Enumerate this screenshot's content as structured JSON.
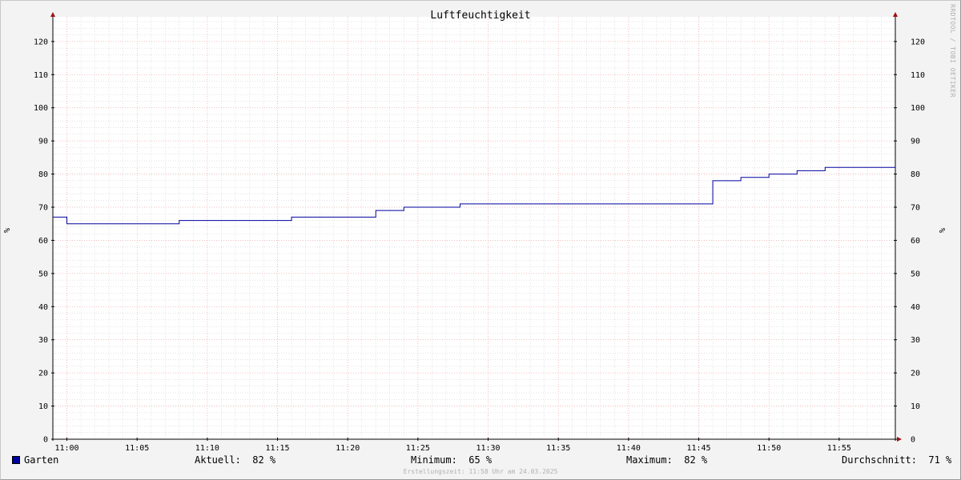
{
  "colors": {
    "line": "#00009e",
    "grid_major": "#f4a0a0",
    "grid_minor": "#c8c8c8",
    "axis": "#000000",
    "arrow": "#a01010"
  },
  "watermark": "RRDTOOL / TOBI OETIKER",
  "footer": "Erstellungszeit: 11:58 Uhr am 24.03.2025",
  "legend": {
    "series_name": "Garten",
    "aktuell_label": "Aktuell:",
    "aktuell_value": "82 %",
    "minimum_label": "Minimum:",
    "minimum_value": "65 %",
    "maximum_label": "Maximum:",
    "maximum_value": "82 %",
    "durchschnitt_label": "Durchschnitt:",
    "durchschnitt_value": "71 %"
  },
  "chart_data": {
    "type": "line",
    "title": "Luftfeuchtigkeit",
    "ylabel": "%",
    "ylabel_right": "%",
    "xlim": [
      "10:59",
      "11:59"
    ],
    "ylim": [
      0,
      126
    ],
    "y_ticks": [
      0,
      10,
      20,
      30,
      40,
      50,
      60,
      70,
      80,
      90,
      100,
      110,
      120
    ],
    "x_ticks": [
      "11:00",
      "11:05",
      "11:10",
      "11:15",
      "11:20",
      "11:25",
      "11:30",
      "11:35",
      "11:40",
      "11:45",
      "11:50",
      "11:55"
    ],
    "grid": true,
    "series": [
      {
        "name": "Garten",
        "step": true,
        "x": [
          "10:59",
          "11:00",
          "11:08",
          "11:16",
          "11:22",
          "11:24",
          "11:28",
          "11:46",
          "11:48",
          "11:50",
          "11:52",
          "11:54",
          "11:59"
        ],
        "y": [
          67,
          65,
          66,
          67,
          69,
          70,
          71,
          78,
          79,
          80,
          81,
          82,
          82
        ]
      }
    ]
  }
}
